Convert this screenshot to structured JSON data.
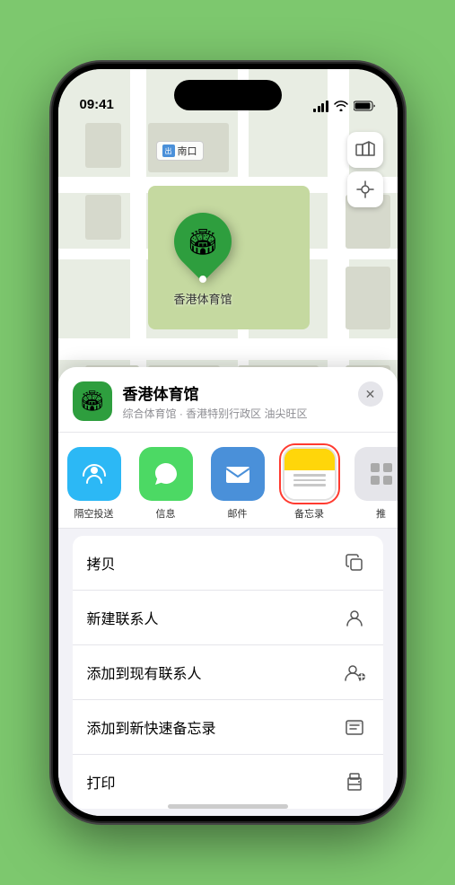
{
  "status_bar": {
    "time": "09:41",
    "signal_label": "signal",
    "wifi_label": "wifi",
    "battery_label": "battery"
  },
  "map": {
    "label_icon": "出",
    "label_text": "南口",
    "map_type_icon": "🗺",
    "location_icon": "compass"
  },
  "venue": {
    "name": "香港体育馆",
    "description": "综合体育馆 · 香港特别行政区 油尖旺区",
    "icon": "🏟"
  },
  "share_items": [
    {
      "id": "airdrop",
      "label": "隔空投送"
    },
    {
      "id": "messages",
      "label": "信息"
    },
    {
      "id": "mail",
      "label": "邮件"
    },
    {
      "id": "notes",
      "label": "备忘录",
      "selected": true
    },
    {
      "id": "more",
      "label": "推"
    }
  ],
  "menu_items": [
    {
      "id": "copy",
      "label": "拷贝",
      "icon": "copy"
    },
    {
      "id": "new-contact",
      "label": "新建联系人",
      "icon": "person"
    },
    {
      "id": "add-existing",
      "label": "添加到现有联系人",
      "icon": "person-add"
    },
    {
      "id": "add-notes",
      "label": "添加到新快速备忘录",
      "icon": "memo"
    },
    {
      "id": "print",
      "label": "打印",
      "icon": "print"
    }
  ]
}
